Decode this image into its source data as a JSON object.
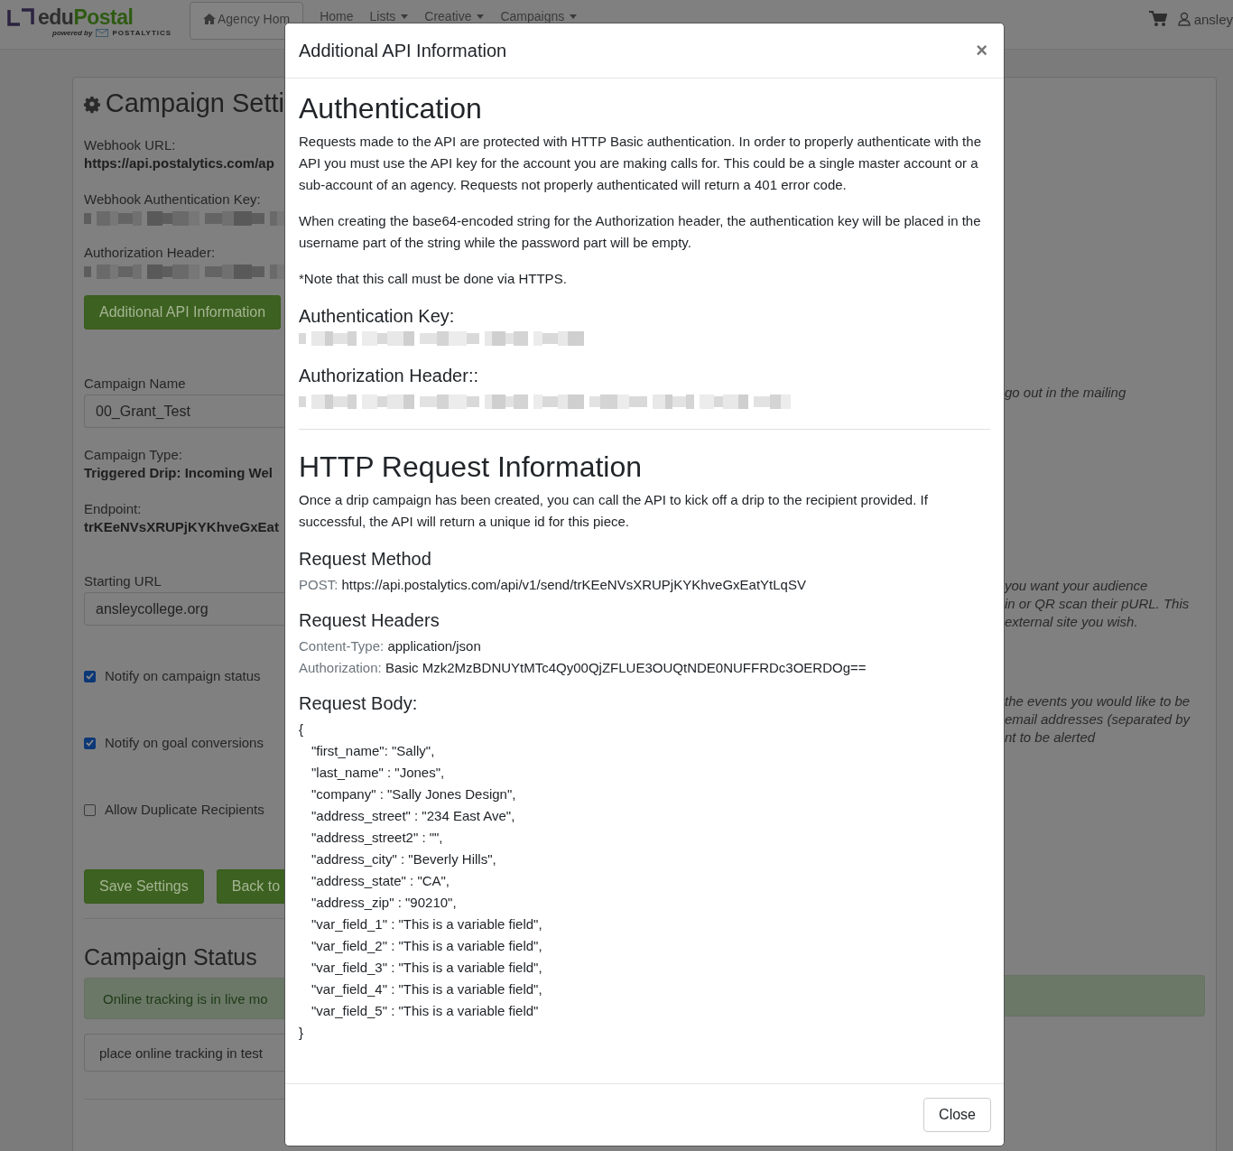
{
  "header": {
    "logo": {
      "prefix": "edu",
      "name": "Postal",
      "tagline": "powered by",
      "brand": "POSTALYTICS"
    },
    "nav": [
      {
        "label": "Agency Hom",
        "kind": "home"
      },
      {
        "label": "Home",
        "kind": "link"
      },
      {
        "label": "Lists",
        "kind": "dropdown"
      },
      {
        "label": "Creative",
        "kind": "dropdown"
      },
      {
        "label": "Campaigns",
        "kind": "dropdown"
      }
    ],
    "user": "ansley"
  },
  "settings": {
    "title": "Campaign Setti",
    "info": [
      {
        "label": "Webhook URL:",
        "kind": "text",
        "value": "https://api.postalytics.com/ap"
      },
      {
        "label": "Webhook Authentication Key:",
        "kind": "redacted"
      },
      {
        "label": "Authorization Header:",
        "kind": "redacted"
      }
    ],
    "api_button": "Additional API Information",
    "fields": [
      {
        "kind": "input",
        "label": "Campaign Name",
        "value": "00_Grant_Test"
      },
      {
        "kind": "static",
        "label": "Campaign Type:",
        "value": "Triggered Drip: Incoming Wel"
      },
      {
        "kind": "static",
        "label": "Endpoint:",
        "value": "trKEeNVsXRUPjKYKhveGxEat"
      },
      {
        "kind": "input",
        "label": "Starting URL",
        "value": "ansleycollege.org"
      },
      {
        "kind": "checkbox",
        "label": "Notify on campaign status",
        "checked": true
      },
      {
        "kind": "checkbox",
        "label": "Notify on goal conversions",
        "checked": true
      },
      {
        "kind": "checkbox",
        "label": "Allow Duplicate Recipients",
        "checked": false
      }
    ],
    "buttons": [
      "Save Settings",
      "Back to"
    ],
    "status": {
      "heading": "Campaign Status",
      "alert": "Online tracking is in live mo",
      "button": "place online tracking in test"
    }
  },
  "side_notes": [
    {
      "lines": [
        "go out in the mailing"
      ]
    },
    {
      "lines": [
        "you want your audience",
        "in or QR scan their pURL. This",
        "external site you wish."
      ]
    },
    {
      "lines": [
        "the events you would like to be",
        "email addresses (separated by",
        "nt to be alerted"
      ]
    }
  ],
  "modal": {
    "title": "Additional API Information",
    "close": "×",
    "auth": {
      "heading": "Authentication",
      "paragraphs": [
        "Requests made to the API are protected with HTTP Basic authentication. In order to properly authenticate with the API you must use the API key for the account you are making calls for. This could be a single master account or a sub-account of an agency. Requests not properly authenticated will return a 401 error code.",
        "When creating the base64-encoded string for the Authorization header, the authentication key will be placed in the username part of the string while the password part will be empty.",
        "*Note that this call must be done via HTTPS."
      ],
      "key_label": "Authentication Key:",
      "header_label": "Authorization Header::"
    },
    "http": {
      "heading": "HTTP Request Information",
      "intro": "Once a drip campaign has been created, you can call the API to kick off a drip to the recipient provided. If successful, the API will return a unique id for this piece.",
      "method_heading": "Request Method",
      "method": {
        "name": "POST:",
        "value": "https://api.postalytics.com/api/v1/send/trKEeNVsXRUPjKYKhveGxEatYtLqSV"
      },
      "headers_heading": "Request Headers",
      "headers": [
        {
          "name": "Content-Type:",
          "value": "application/json"
        },
        {
          "name": "Authorization:",
          "value": "Basic Mzk2MzBDNUYtMTc4Qy00QjZFLUE3OUQtNDE0NUFFRDc3OERDOg=="
        }
      ],
      "body_heading": "Request Body:",
      "body_open": "{",
      "body_lines": [
        "\"first_name\": \"Sally\",",
        "\"last_name\" : \"Jones\",",
        "\"company\" : \"Sally Jones Design\",",
        "\"address_street\" : \"234 East Ave\",",
        "\"address_street2\" : \"\",",
        "\"address_city\" : \"Beverly Hills\",",
        "\"address_state\" : \"CA\",",
        "\"address_zip\" : \"90210\",",
        "\"var_field_1\" : \"This is a variable field\",",
        "\"var_field_2\" : \"This is a variable field\",",
        "\"var_field_3\" : \"This is a variable field\",",
        "\"var_field_4\" : \"This is a variable field\",",
        "\"var_field_5\" : \"This is a variable field\""
      ],
      "body_close": "}"
    },
    "footer_button": "Close"
  }
}
